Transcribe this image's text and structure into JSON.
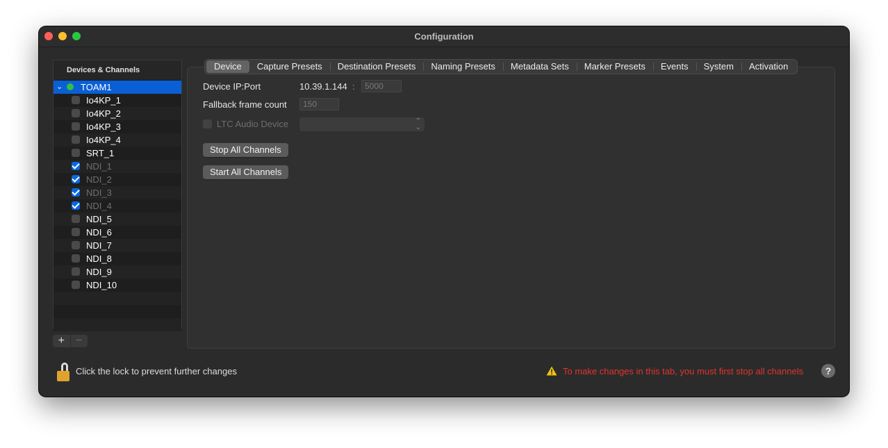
{
  "window": {
    "title": "Configuration"
  },
  "sidebar": {
    "header": "Devices & Channels",
    "device": {
      "label": "TOAM1",
      "expanded": true,
      "status_color": "#31c23f"
    },
    "channels": [
      {
        "label": "Io4KP_1",
        "checked": false,
        "disabled": false
      },
      {
        "label": "Io4KP_2",
        "checked": false,
        "disabled": false
      },
      {
        "label": "Io4KP_3",
        "checked": false,
        "disabled": false
      },
      {
        "label": "Io4KP_4",
        "checked": false,
        "disabled": false
      },
      {
        "label": "SRT_1",
        "checked": false,
        "disabled": false
      },
      {
        "label": "NDI_1",
        "checked": true,
        "disabled": true
      },
      {
        "label": "NDI_2",
        "checked": true,
        "disabled": true
      },
      {
        "label": "NDI_3",
        "checked": true,
        "disabled": true
      },
      {
        "label": "NDI_4",
        "checked": true,
        "disabled": true
      },
      {
        "label": "NDI_5",
        "checked": false,
        "disabled": false
      },
      {
        "label": "NDI_6",
        "checked": false,
        "disabled": false
      },
      {
        "label": "NDI_7",
        "checked": false,
        "disabled": false
      },
      {
        "label": "NDI_8",
        "checked": false,
        "disabled": false
      },
      {
        "label": "NDI_9",
        "checked": false,
        "disabled": false
      },
      {
        "label": "NDI_10",
        "checked": false,
        "disabled": false
      }
    ],
    "add_label": "+",
    "remove_label": "−"
  },
  "tabs": [
    {
      "label": "Device",
      "active": true
    },
    {
      "label": "Capture Presets",
      "active": false
    },
    {
      "label": "Destination Presets",
      "active": false
    },
    {
      "label": "Naming Presets",
      "active": false
    },
    {
      "label": "Metadata Sets",
      "active": false
    },
    {
      "label": "Marker Presets",
      "active": false
    },
    {
      "label": "Events",
      "active": false
    },
    {
      "label": "System",
      "active": false
    },
    {
      "label": "Activation",
      "active": false
    }
  ],
  "device": {
    "ip_port_label": "Device IP:Port",
    "ip_value": "10.39.1.144",
    "separator": ":",
    "port_value": "5000",
    "fallback_label": "Fallback frame count",
    "fallback_value": "150",
    "ltc_label": "LTC Audio Device",
    "ltc_value": "",
    "stop_all_label": "Stop All Channels",
    "start_all_label": "Start All Channels"
  },
  "footer": {
    "lock_text": "Click the lock to prevent further changes",
    "warning_text": "To make changes in this tab, you must first stop all channels",
    "help_label": "?",
    "warning_color": "#e0342f"
  }
}
